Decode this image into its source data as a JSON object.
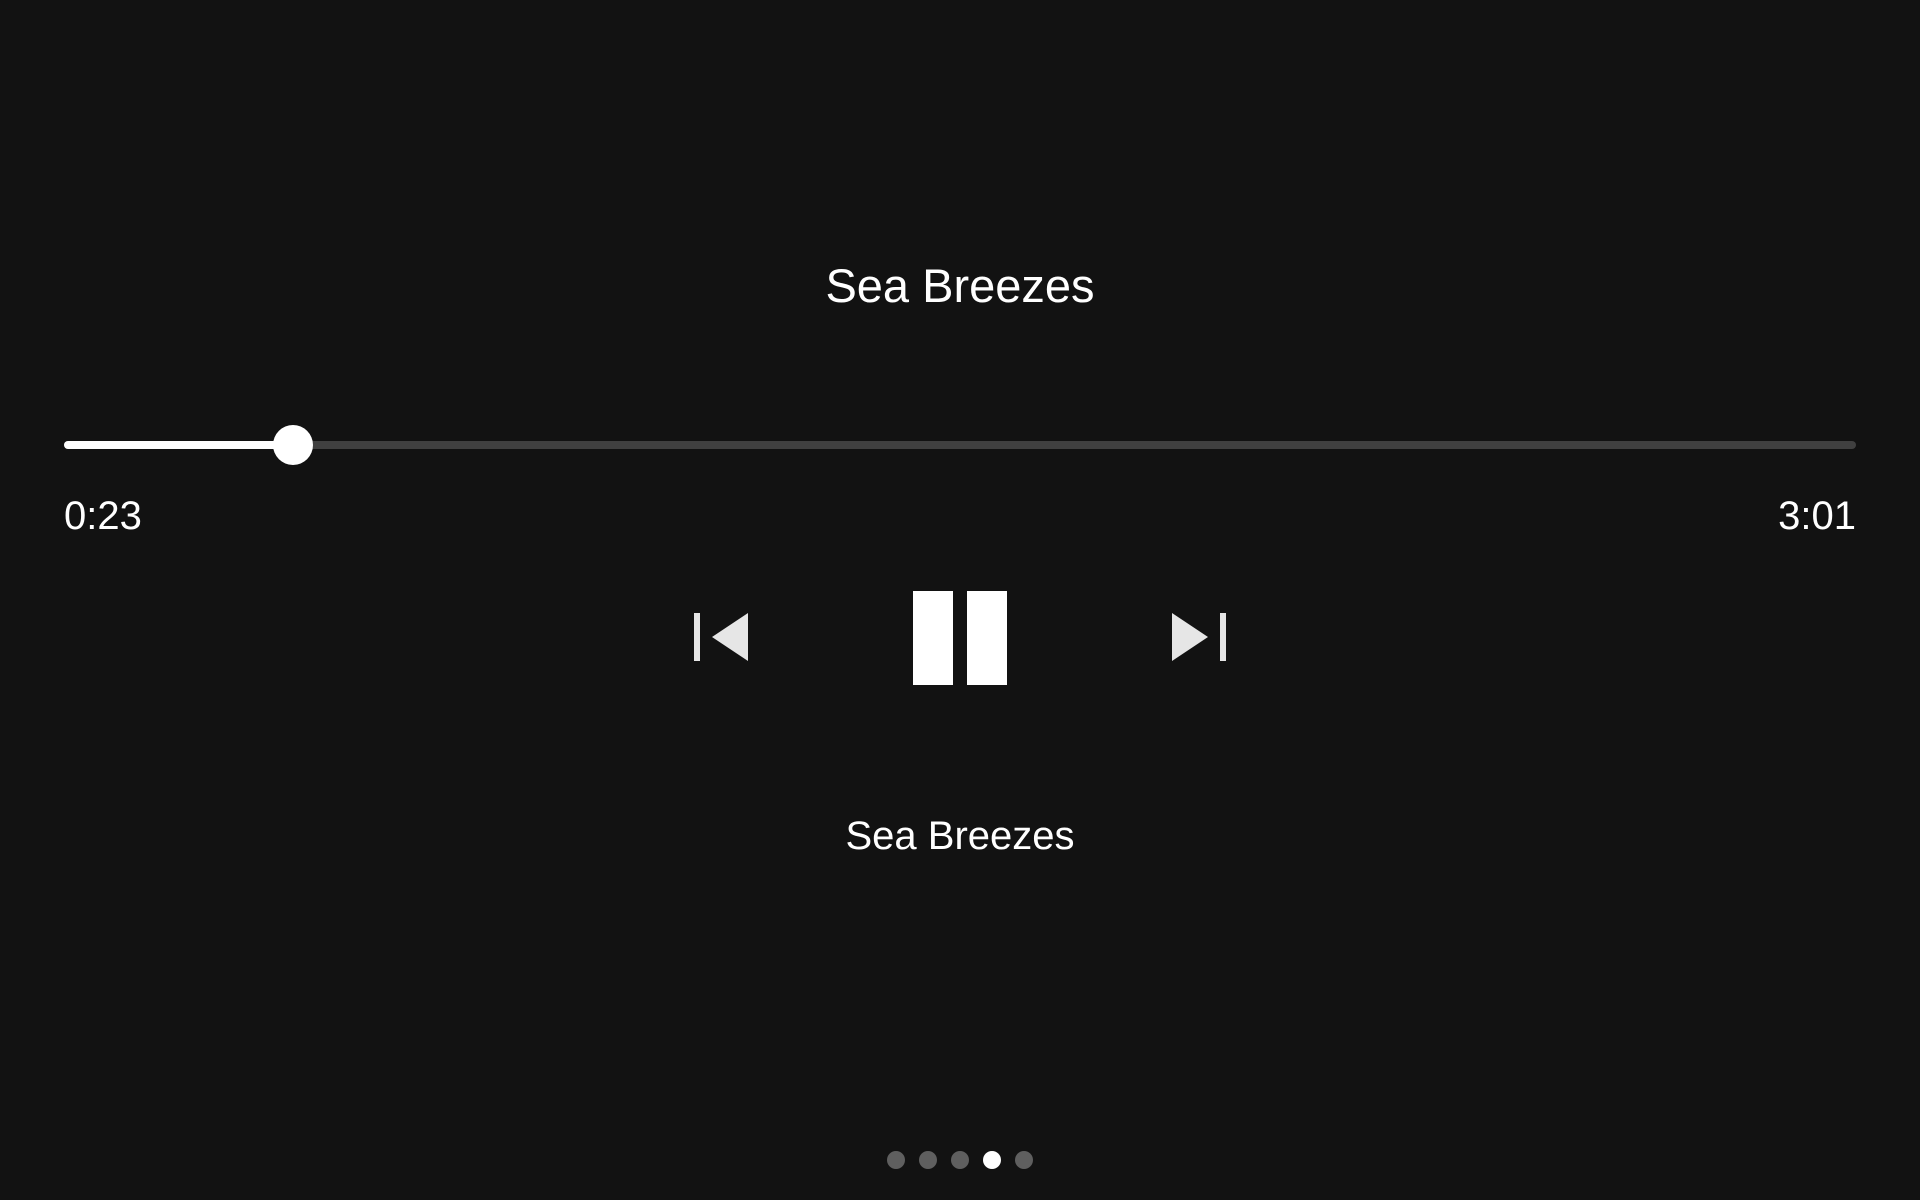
{
  "player": {
    "track_title": "Sea Breezes",
    "subtitle": "Sea Breezes",
    "elapsed": "0:23",
    "duration": "3:01",
    "progress_fraction": 0.128
  },
  "controls": {
    "previous_icon": "skip-previous-icon",
    "play_pause_icon": "pause-icon",
    "next_icon": "skip-next-icon"
  },
  "pager": {
    "count": 5,
    "active_index": 3
  },
  "colors": {
    "background": "#121212",
    "foreground": "#ffffff",
    "track_inactive": "#404040",
    "dot_inactive": "#5f5f5f"
  }
}
